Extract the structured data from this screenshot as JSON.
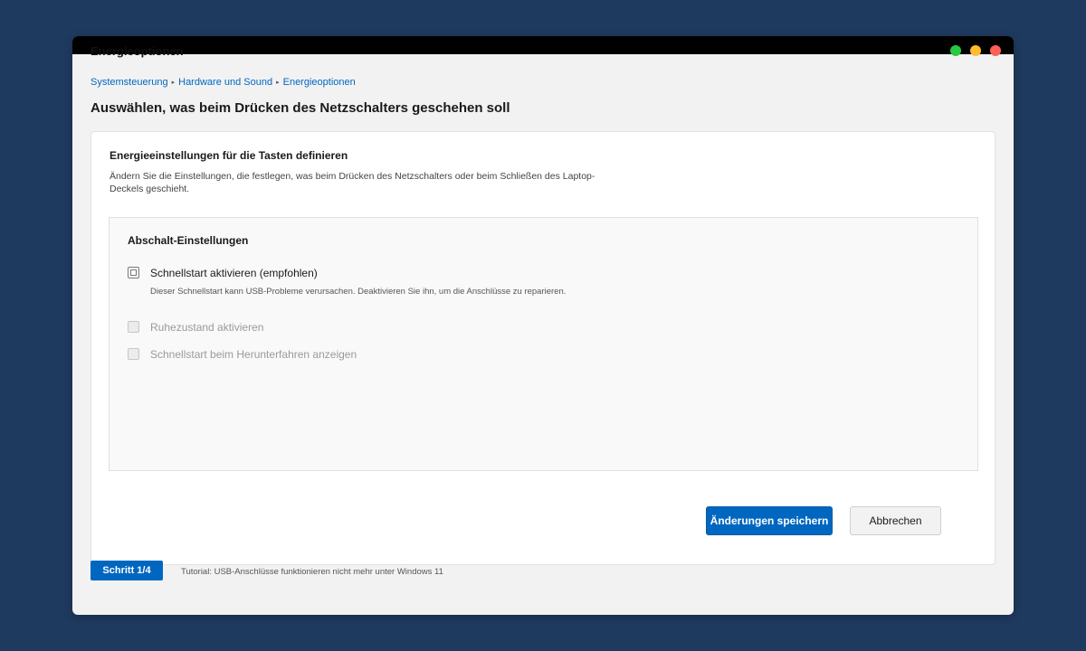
{
  "window": {
    "title": "Energieoptionen",
    "controls": {
      "green_color": "#28c840",
      "yellow_color": "#febc2e",
      "red_color": "#ff5f57"
    }
  },
  "breadcrumb": {
    "items": [
      "Systemsteuerung",
      "Hardware und Sound",
      "Energieoptionen"
    ],
    "separator": "▸"
  },
  "page": {
    "title": "Auswählen, was beim Drücken des Netzschalters geschehen soll"
  },
  "card": {
    "heading": "Energieeinstellungen für die Tasten definieren",
    "description": "Ändern Sie die Einstellungen, die festlegen, was beim Drücken des Netzschalters oder beim Schließen des Laptop-Deckels geschieht."
  },
  "shutdown_settings": {
    "heading": "Abschalt-Einstellungen",
    "options": [
      {
        "label": "Schnellstart aktivieren (empfohlen)",
        "hint": "Dieser Schnellstart kann USB-Probleme verursachen. Deaktivieren Sie ihn, um die Anschlüsse zu reparieren.",
        "checked": false,
        "enabled": true
      },
      {
        "label": "Ruhezustand aktivieren",
        "checked": false,
        "enabled": false
      },
      {
        "label": "Schnellstart beim Herunterfahren anzeigen",
        "checked": false,
        "enabled": false
      }
    ]
  },
  "buttons": {
    "save_label": "Änderungen speichern",
    "cancel_label": "Abbrechen"
  },
  "tutorial": {
    "step_label": "Schritt 1/4",
    "text": "Tutorial: USB-Anschlüsse funktionieren nicht mehr unter Windows 11"
  },
  "colors": {
    "accent": "#0067c0",
    "desktop": "#1f3a5f"
  }
}
